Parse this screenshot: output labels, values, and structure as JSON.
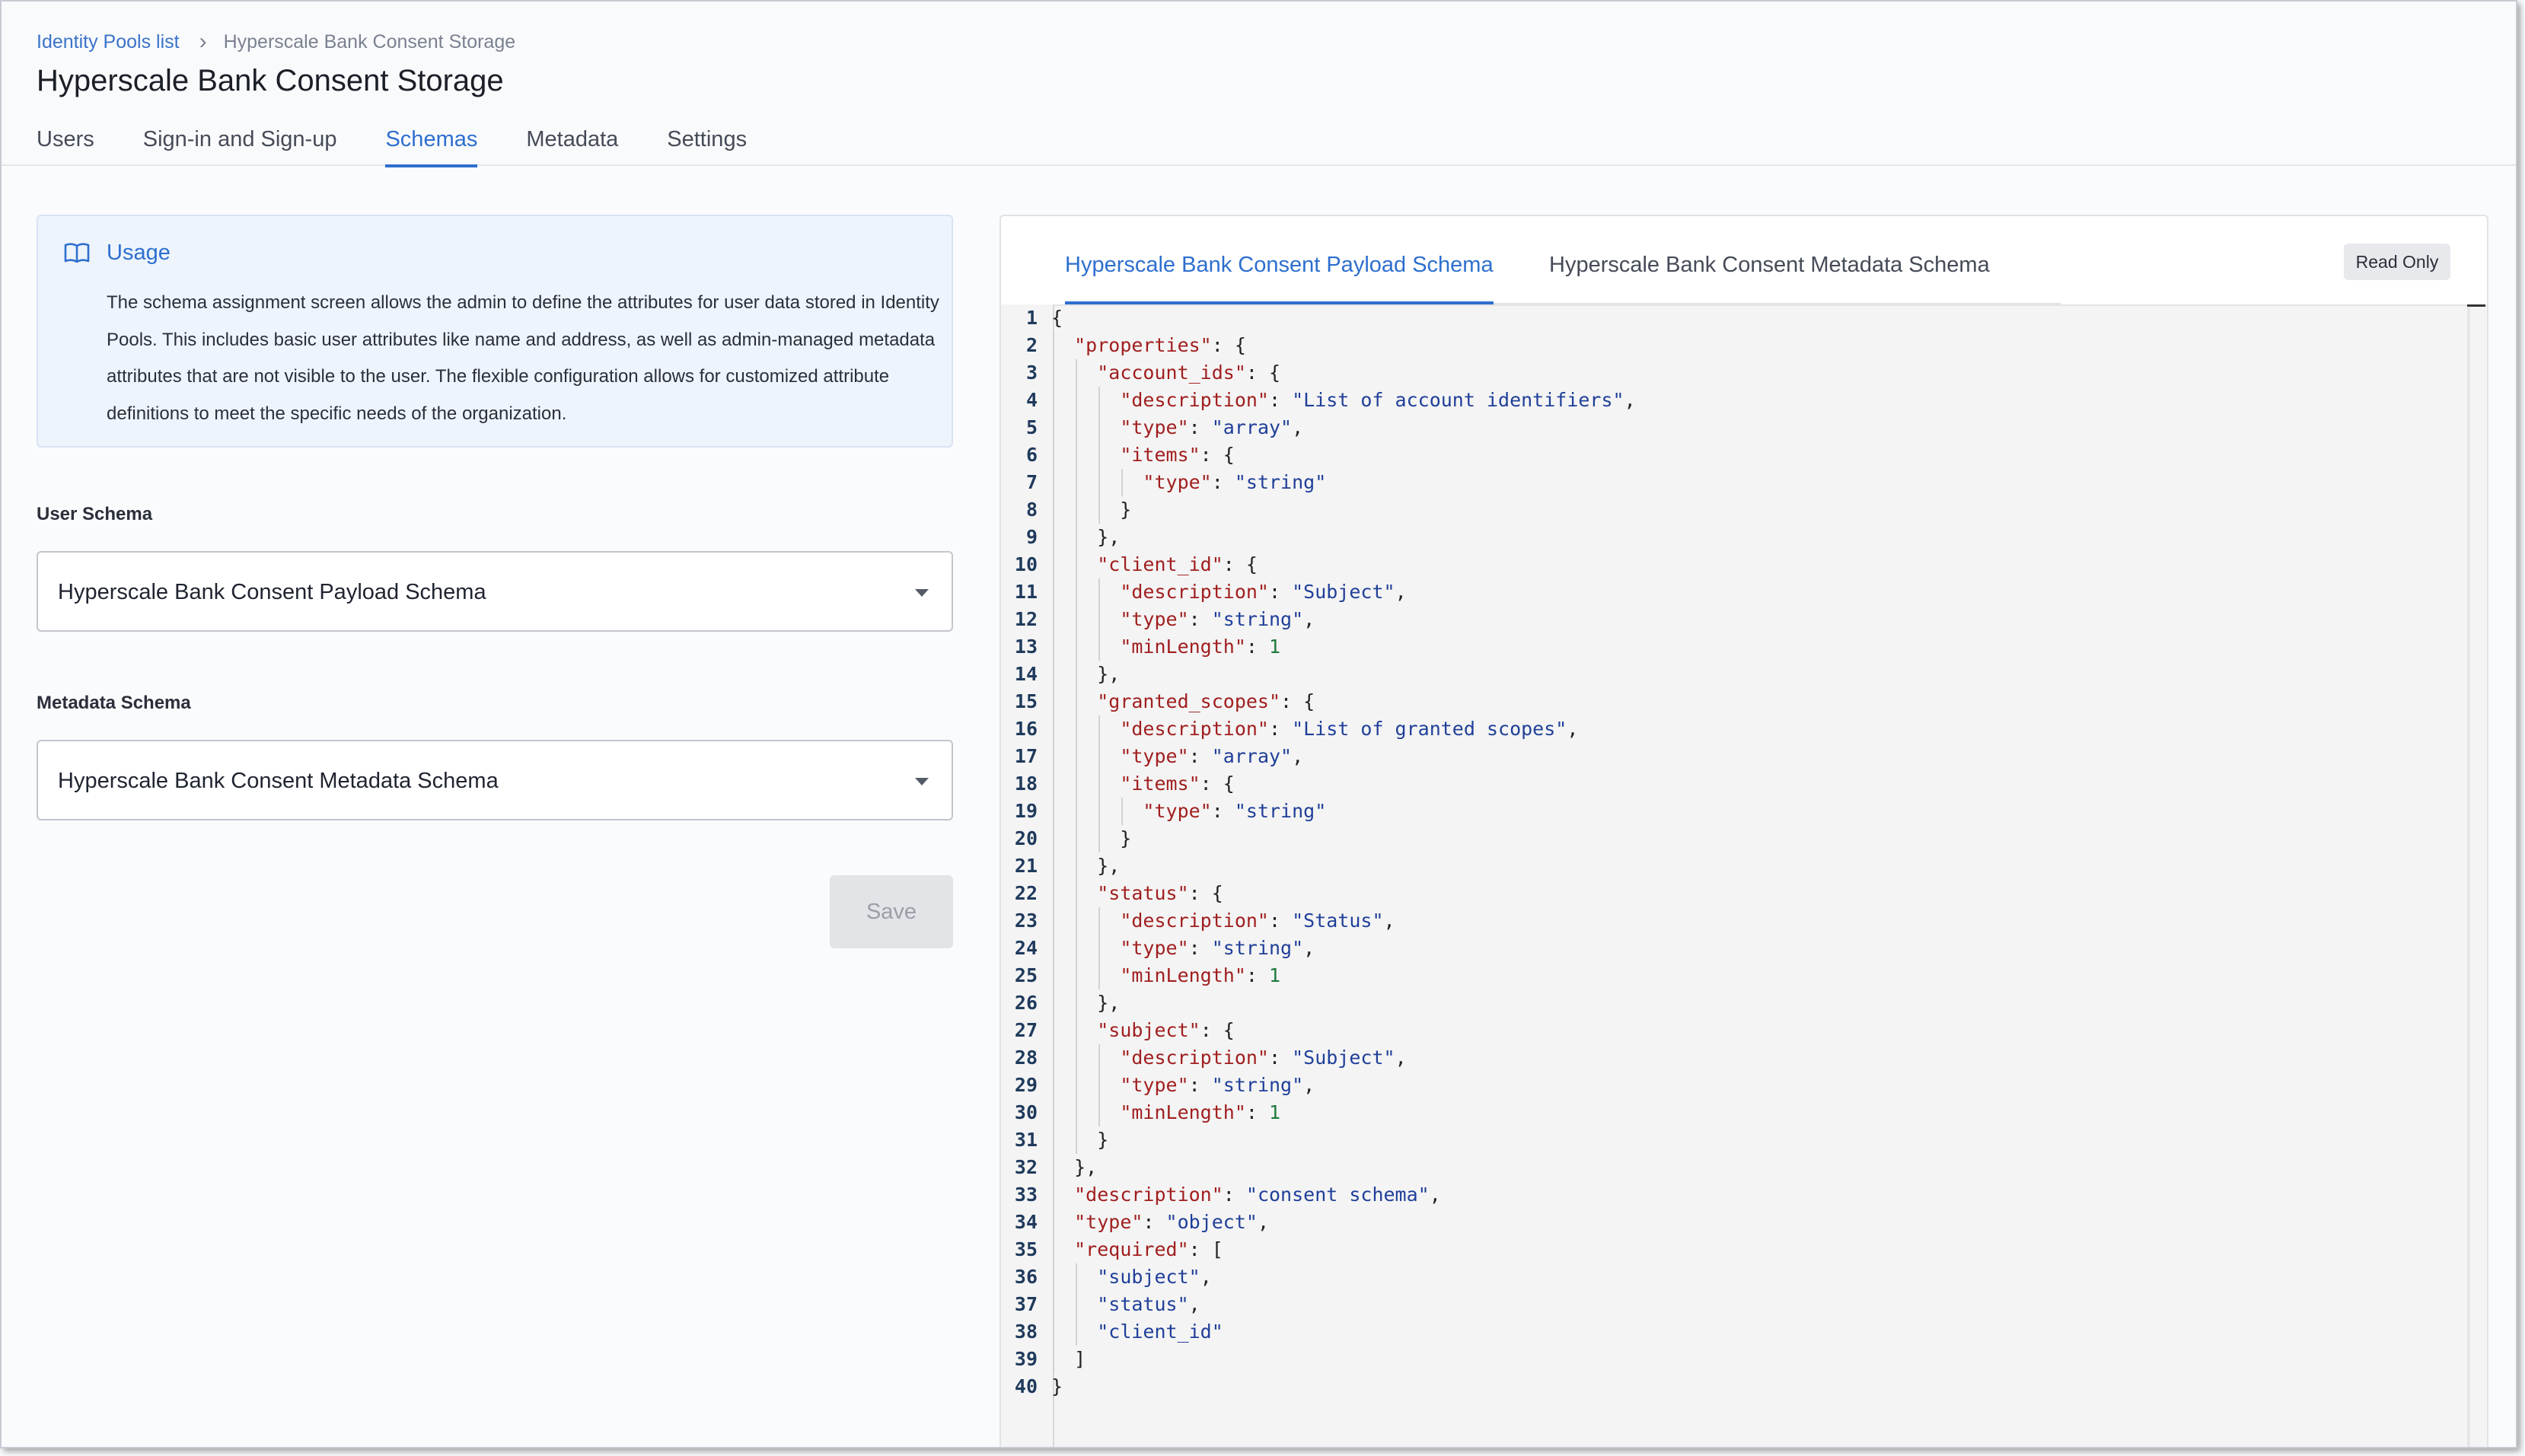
{
  "breadcrumb": {
    "parent": "Identity Pools list",
    "separator": "›",
    "current": "Hyperscale Bank Consent Storage"
  },
  "page_title": "Hyperscale Bank Consent Storage",
  "main_tabs": [
    {
      "label": "Users",
      "active": false
    },
    {
      "label": "Sign-in and Sign-up",
      "active": false
    },
    {
      "label": "Schemas",
      "active": true
    },
    {
      "label": "Metadata",
      "active": false
    },
    {
      "label": "Settings",
      "active": false
    }
  ],
  "usage": {
    "icon": "book-open-icon",
    "title": "Usage",
    "text": "The schema assignment screen allows the admin to define the attributes for user data stored in Identity Pools. This includes basic user attributes like name and address, as well as admin-managed metadata attributes that are not visible to the user. The flexible configuration allows for customized attribute definitions to meet the specific needs of the organization."
  },
  "user_schema": {
    "label": "User Schema",
    "value": "Hyperscale Bank Consent Payload Schema"
  },
  "metadata_schema": {
    "label": "Metadata Schema",
    "value": "Hyperscale Bank Consent Metadata Schema"
  },
  "save_label": "Save",
  "schema_tabs": [
    {
      "label": "Hyperscale Bank Consent Payload Schema",
      "active": true
    },
    {
      "label": "Hyperscale Bank Consent Metadata Schema",
      "active": false
    }
  ],
  "read_only_label": "Read Only",
  "colors": {
    "accent": "#2e6fcf",
    "json_key": "#a11f1f",
    "json_string": "#1f3f99",
    "json_number": "#1f7a3e"
  },
  "code_lines": [
    [
      [
        "p",
        "{"
      ]
    ],
    [
      [
        "p",
        "  "
      ],
      [
        "k",
        "\"properties\""
      ],
      [
        "p",
        ": {"
      ]
    ],
    [
      [
        "p",
        "    "
      ],
      [
        "k",
        "\"account_ids\""
      ],
      [
        "p",
        ": {"
      ]
    ],
    [
      [
        "p",
        "      "
      ],
      [
        "k",
        "\"description\""
      ],
      [
        "p",
        ": "
      ],
      [
        "s",
        "\"List of account identifiers\""
      ],
      [
        "p",
        ","
      ]
    ],
    [
      [
        "p",
        "      "
      ],
      [
        "k",
        "\"type\""
      ],
      [
        "p",
        ": "
      ],
      [
        "s",
        "\"array\""
      ],
      [
        "p",
        ","
      ]
    ],
    [
      [
        "p",
        "      "
      ],
      [
        "k",
        "\"items\""
      ],
      [
        "p",
        ": {"
      ]
    ],
    [
      [
        "p",
        "        "
      ],
      [
        "k",
        "\"type\""
      ],
      [
        "p",
        ": "
      ],
      [
        "s",
        "\"string\""
      ]
    ],
    [
      [
        "p",
        "      }"
      ]
    ],
    [
      [
        "p",
        "    },"
      ]
    ],
    [
      [
        "p",
        "    "
      ],
      [
        "k",
        "\"client_id\""
      ],
      [
        "p",
        ": {"
      ]
    ],
    [
      [
        "p",
        "      "
      ],
      [
        "k",
        "\"description\""
      ],
      [
        "p",
        ": "
      ],
      [
        "s",
        "\"Subject\""
      ],
      [
        "p",
        ","
      ]
    ],
    [
      [
        "p",
        "      "
      ],
      [
        "k",
        "\"type\""
      ],
      [
        "p",
        ": "
      ],
      [
        "s",
        "\"string\""
      ],
      [
        "p",
        ","
      ]
    ],
    [
      [
        "p",
        "      "
      ],
      [
        "k",
        "\"minLength\""
      ],
      [
        "p",
        ": "
      ],
      [
        "n",
        "1"
      ]
    ],
    [
      [
        "p",
        "    },"
      ]
    ],
    [
      [
        "p",
        "    "
      ],
      [
        "k",
        "\"granted_scopes\""
      ],
      [
        "p",
        ": {"
      ]
    ],
    [
      [
        "p",
        "      "
      ],
      [
        "k",
        "\"description\""
      ],
      [
        "p",
        ": "
      ],
      [
        "s",
        "\"List of granted scopes\""
      ],
      [
        "p",
        ","
      ]
    ],
    [
      [
        "p",
        "      "
      ],
      [
        "k",
        "\"type\""
      ],
      [
        "p",
        ": "
      ],
      [
        "s",
        "\"array\""
      ],
      [
        "p",
        ","
      ]
    ],
    [
      [
        "p",
        "      "
      ],
      [
        "k",
        "\"items\""
      ],
      [
        "p",
        ": {"
      ]
    ],
    [
      [
        "p",
        "        "
      ],
      [
        "k",
        "\"type\""
      ],
      [
        "p",
        ": "
      ],
      [
        "s",
        "\"string\""
      ]
    ],
    [
      [
        "p",
        "      }"
      ]
    ],
    [
      [
        "p",
        "    },"
      ]
    ],
    [
      [
        "p",
        "    "
      ],
      [
        "k",
        "\"status\""
      ],
      [
        "p",
        ": {"
      ]
    ],
    [
      [
        "p",
        "      "
      ],
      [
        "k",
        "\"description\""
      ],
      [
        "p",
        ": "
      ],
      [
        "s",
        "\"Status\""
      ],
      [
        "p",
        ","
      ]
    ],
    [
      [
        "p",
        "      "
      ],
      [
        "k",
        "\"type\""
      ],
      [
        "p",
        ": "
      ],
      [
        "s",
        "\"string\""
      ],
      [
        "p",
        ","
      ]
    ],
    [
      [
        "p",
        "      "
      ],
      [
        "k",
        "\"minLength\""
      ],
      [
        "p",
        ": "
      ],
      [
        "n",
        "1"
      ]
    ],
    [
      [
        "p",
        "    },"
      ]
    ],
    [
      [
        "p",
        "    "
      ],
      [
        "k",
        "\"subject\""
      ],
      [
        "p",
        ": {"
      ]
    ],
    [
      [
        "p",
        "      "
      ],
      [
        "k",
        "\"description\""
      ],
      [
        "p",
        ": "
      ],
      [
        "s",
        "\"Subject\""
      ],
      [
        "p",
        ","
      ]
    ],
    [
      [
        "p",
        "      "
      ],
      [
        "k",
        "\"type\""
      ],
      [
        "p",
        ": "
      ],
      [
        "s",
        "\"string\""
      ],
      [
        "p",
        ","
      ]
    ],
    [
      [
        "p",
        "      "
      ],
      [
        "k",
        "\"minLength\""
      ],
      [
        "p",
        ": "
      ],
      [
        "n",
        "1"
      ]
    ],
    [
      [
        "p",
        "    }"
      ]
    ],
    [
      [
        "p",
        "  },"
      ]
    ],
    [
      [
        "p",
        "  "
      ],
      [
        "k",
        "\"description\""
      ],
      [
        "p",
        ": "
      ],
      [
        "s",
        "\"consent schema\""
      ],
      [
        "p",
        ","
      ]
    ],
    [
      [
        "p",
        "  "
      ],
      [
        "k",
        "\"type\""
      ],
      [
        "p",
        ": "
      ],
      [
        "s",
        "\"object\""
      ],
      [
        "p",
        ","
      ]
    ],
    [
      [
        "p",
        "  "
      ],
      [
        "k",
        "\"required\""
      ],
      [
        "p",
        ": ["
      ]
    ],
    [
      [
        "p",
        "    "
      ],
      [
        "s",
        "\"subject\""
      ],
      [
        "p",
        ","
      ]
    ],
    [
      [
        "p",
        "    "
      ],
      [
        "s",
        "\"status\""
      ],
      [
        "p",
        ","
      ]
    ],
    [
      [
        "p",
        "    "
      ],
      [
        "s",
        "\"client_id\""
      ]
    ],
    [
      [
        "p",
        "  ]"
      ]
    ],
    [
      [
        "p",
        "}"
      ]
    ]
  ]
}
